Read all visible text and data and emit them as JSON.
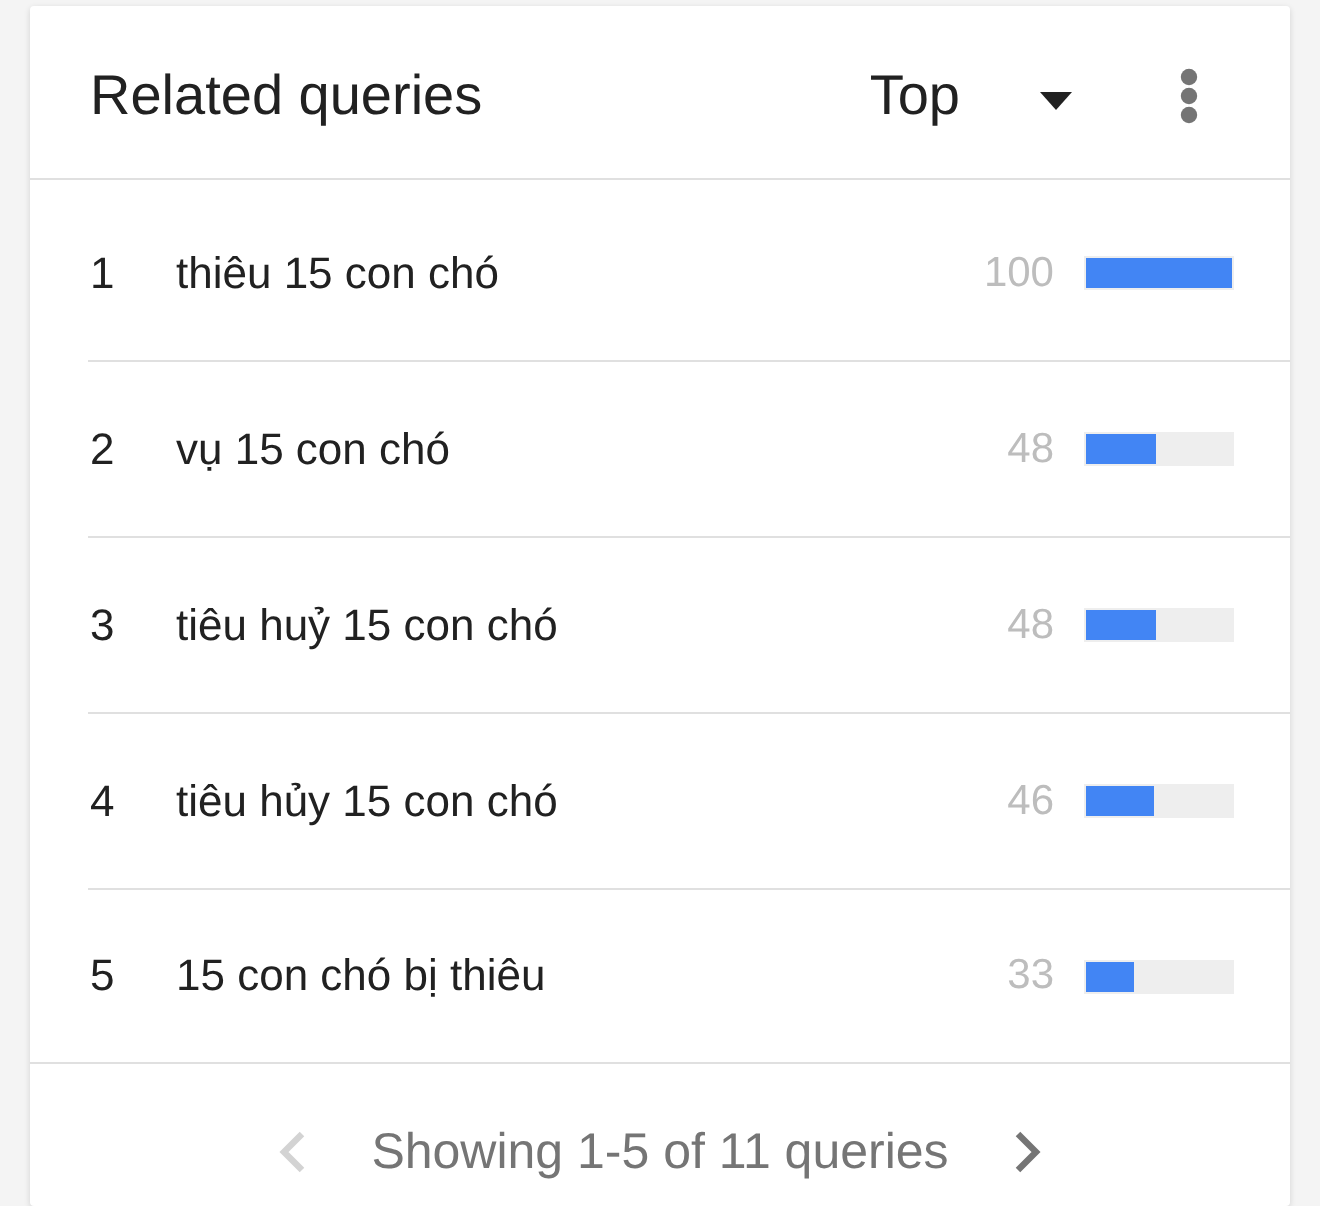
{
  "card": {
    "title": "Related queries",
    "filter": {
      "label": "Top"
    }
  },
  "rows": [
    {
      "rank": "1",
      "query": "thiêu 15 con chó",
      "value": "100",
      "level": 1
    },
    {
      "rank": "2",
      "query": "vụ 15 con chó",
      "value": "48",
      "level": 0.48
    },
    {
      "rank": "3",
      "query": "tiêu huỷ 15 con chó",
      "value": "48",
      "level": 0.48
    },
    {
      "rank": "4",
      "query": "tiêu hủy 15 con chó",
      "value": "46",
      "level": 0.46
    },
    {
      "rank": "5",
      "query": "15 con chó bị thiêu",
      "value": "33",
      "level": 0.33
    }
  ],
  "pager": {
    "text": "Showing 1-5 of 11 queries",
    "previous": {
      "disabled": true
    },
    "next": {
      "disabled": false
    }
  }
}
